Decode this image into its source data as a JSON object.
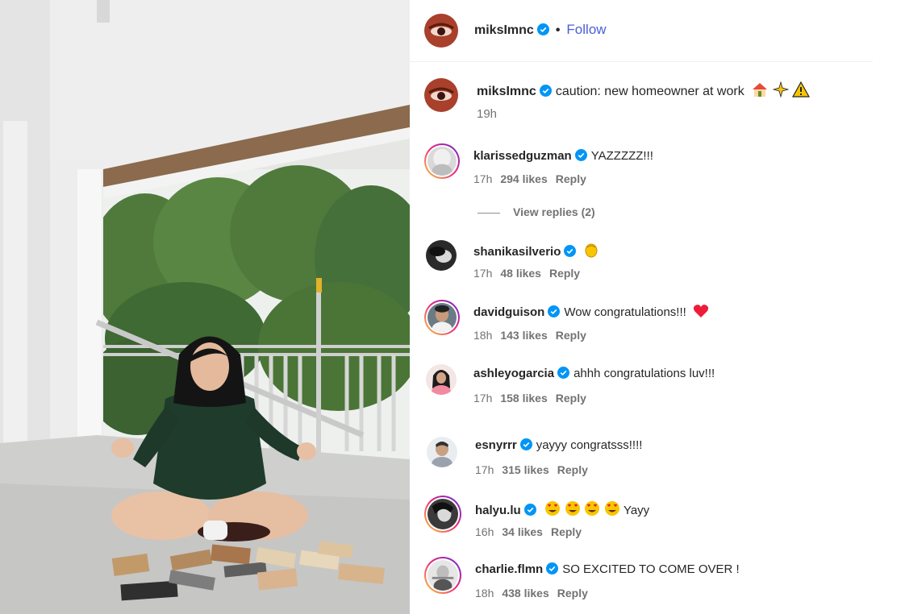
{
  "post": {
    "author": "miksImnc",
    "follow_label": "Follow",
    "dot": "•"
  },
  "caption": {
    "author": "miksImnc",
    "text": "caution: new homeowner at work",
    "emojis": [
      "house-icon",
      "sparkles-icon",
      "warning-icon"
    ],
    "time": "19h"
  },
  "comments": [
    {
      "user": "klarissedguzman",
      "text": "YAZZZZZ!!!",
      "time": "17h",
      "likes": "294 likes",
      "reply": "Reply",
      "view_replies": "View replies (2)"
    },
    {
      "user": "shanikasilverio",
      "text": "",
      "emoji": "clap-icon",
      "time": "17h",
      "likes": "48 likes",
      "reply": "Reply"
    },
    {
      "user": "davidguison",
      "text": "Wow congratulations!!!",
      "emoji": "heart-icon",
      "time": "18h",
      "likes": "143 likes",
      "reply": "Reply"
    },
    {
      "user": "ashleyogarcia",
      "text": "ahhh congratulations luv!!!",
      "time": "17h",
      "likes": "158 likes",
      "reply": "Reply"
    },
    {
      "user": "esnyrrr",
      "text": "yayyy congratsss!!!!",
      "time": "17h",
      "likes": "315 likes",
      "reply": "Reply"
    },
    {
      "user": "halyu.lu",
      "text": "Yayy",
      "emoji": "heart-eyes-icon",
      "time": "16h",
      "likes": "34 likes",
      "reply": "Reply"
    },
    {
      "user": "charlie.flmn",
      "text": "SO EXCITED TO COME OVER !",
      "time": "18h",
      "likes": "438 likes",
      "reply": "Reply"
    }
  ],
  "colors": {
    "follow": "#4a5fd6",
    "verified": "#0095f6",
    "meta": "#737373",
    "heart": "#ed1c3a"
  }
}
